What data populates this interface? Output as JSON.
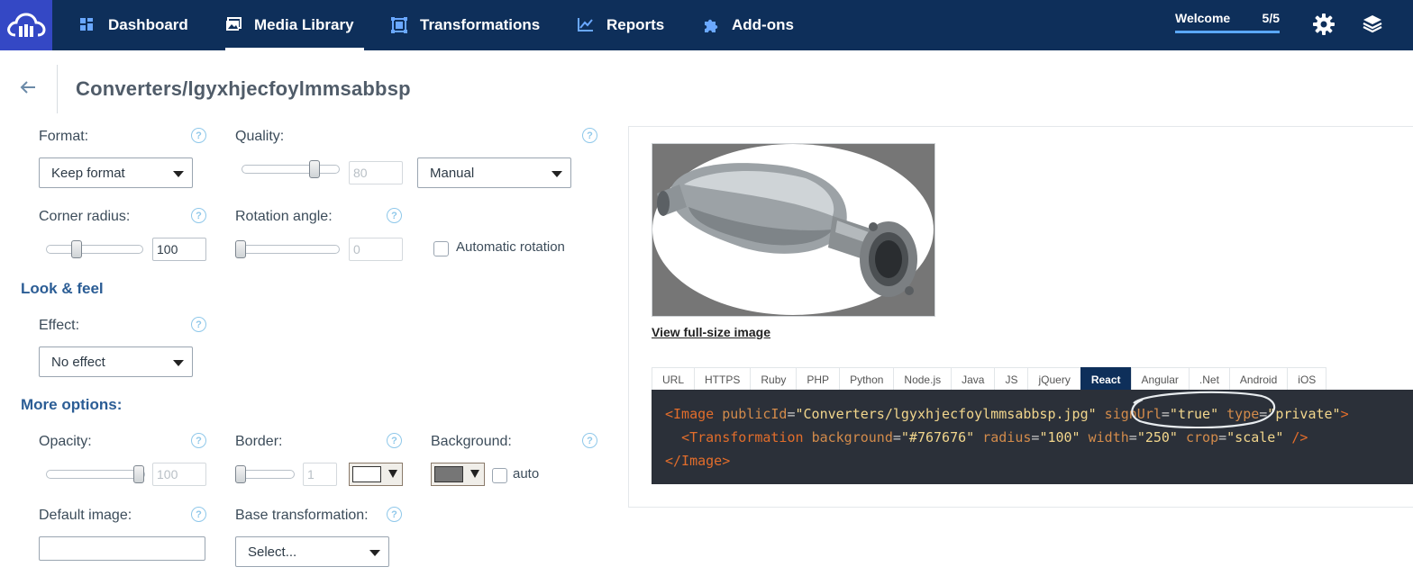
{
  "nav": {
    "items": [
      {
        "label": "Dashboard",
        "icon": "dashboard-icon"
      },
      {
        "label": "Media Library",
        "icon": "media-library-icon"
      },
      {
        "label": "Transformations",
        "icon": "transformations-icon"
      },
      {
        "label": "Reports",
        "icon": "reports-icon"
      },
      {
        "label": "Add-ons",
        "icon": "puzzle-icon"
      }
    ],
    "active": "Media Library",
    "welcome_label": "Welcome",
    "welcome_count": "5/5",
    "brand_color": "#0e2f5a",
    "logo_color": "#3448c5"
  },
  "header": {
    "title": "Converters/lgyxhjecfoylmmsabbsp"
  },
  "form": {
    "format": {
      "label": "Format:",
      "value": "Keep format"
    },
    "quality": {
      "label": "Quality:",
      "value": "80",
      "mode": "Manual",
      "slider_fraction": 0.8
    },
    "corner_radius": {
      "label": "Corner radius:",
      "value": "100",
      "slider_fraction": 0.3
    },
    "rotation": {
      "label": "Rotation angle:",
      "value": "0",
      "auto_label": "Automatic rotation",
      "slider_fraction": 0
    },
    "look_feel_heading": "Look & feel",
    "effect": {
      "label": "Effect:",
      "value": "No effect"
    },
    "more_options_heading": "More options:",
    "opacity": {
      "label": "Opacity:",
      "value": "100",
      "slider_fraction": 1
    },
    "border": {
      "label": "Border:",
      "value": "1",
      "color": "#ffffff",
      "slider_fraction": 0
    },
    "background": {
      "label": "Background:",
      "color": "#767676",
      "auto_label": "auto"
    },
    "default_image": {
      "label": "Default image:",
      "value": ""
    },
    "base_transformation": {
      "label": "Base transformation:",
      "value": "Select..."
    },
    "help_glyph": "?"
  },
  "preview": {
    "view_full_label": "View full-size image",
    "background_color": "#767676",
    "tabs": [
      "URL",
      "HTTPS",
      "Ruby",
      "PHP",
      "Python",
      "Node.js",
      "Java",
      "JS",
      "jQuery",
      "React",
      "Angular",
      ".Net",
      "Android",
      "iOS"
    ],
    "active_tab": "React",
    "code": {
      "line1": {
        "open": "<Image",
        "attrs": [
          {
            "name": "publicId",
            "value": "\"Converters/lgyxhjecfoylmmsabbsp.jpg\""
          },
          {
            "name": "signUrl",
            "value": "\"true\""
          },
          {
            "name": "type",
            "value": "\"private\""
          }
        ],
        "close": ">"
      },
      "line2": {
        "open": "<Transformation",
        "attrs": [
          {
            "name": "background",
            "value": "\"#767676\""
          },
          {
            "name": "radius",
            "value": "\"100\""
          },
          {
            "name": "width",
            "value": "\"250\""
          },
          {
            "name": "crop",
            "value": "\"scale\""
          }
        ],
        "close": "/>"
      },
      "line3": "</Image>"
    }
  }
}
